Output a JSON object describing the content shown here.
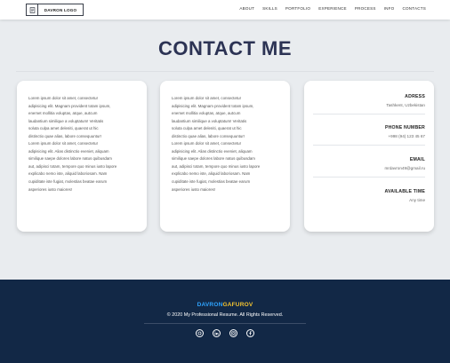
{
  "header": {
    "logo_text": "DAVRON LOGO",
    "nav": [
      "ABOUT",
      "SKILLS",
      "PORTFOLIO",
      "EXPERIENCE",
      "PROCESS",
      "INFO",
      "CONTACTS"
    ]
  },
  "main": {
    "title": "CONTACT ME",
    "card1_lines": [
      "Lorem ipsum dolor sit amet, consectetur",
      "adipisicing elit. Magnam provident totam ipsum,",
      "enemet mollitia voluptas, atque, autcum",
      "laudantium similique a voluptatum! Veritatis",
      "soluta culpa amet deleniti, quaerat ut hic",
      "distinctio quae alias, labore consequuntur!",
      "Lorem ipsum dolor sit amet, consectetur",
      "adipisicing elit. Alias distinctio eveniet, aliquam",
      "similique saepe dolores labore natus quibusdam",
      "aut, adipisci totam, tempore quo minus iusto lapore",
      "explicabo nemo iste, aliquid laboriosam. Nam",
      "cupiditate iste fugiat, molestias beatae earum",
      "asperiores iusto maiores!"
    ],
    "card2_lines": [
      "Lorem ipsum dolor sit amet, consectetur",
      "adipisicing elit. Magnam provident totam ipsum,",
      "enemet mollitia voluptas, atque, autcum",
      "laudantium similique a voluptatum! Veritatis",
      "soluta culpa amet deleniti, quaerat ut hic",
      "distinctio quae alias, labore consequuntur!",
      "Lorem ipsum dolor sit amet, consectetur",
      "adipisicing elit. Alias distinctio eveniet, aliquam",
      "similique saepe dolores labore natus quibusdam",
      "aut, adipisci totam, tempore quo minus iusto lapore",
      "explicabo nemo iste, aliquid laboriosam. Nam",
      "cupiditate iste fugiat, molestias beatae earum",
      "asperiores iusto maiores!"
    ],
    "info": {
      "address_label": "ADRESS",
      "address_value": "Tashkent, Uzbekistan",
      "phone_label": "PHONE NUMBER",
      "phone_value": "+998 (94) 123 45 67",
      "email_label": "EMAIL",
      "email_value": "mrdavron49@gmail.ru",
      "time_label": "AVAILABLE TIME",
      "time_value": "Any time"
    }
  },
  "footer": {
    "brand_part1": "DAVRON",
    "brand_part2": "GAFUROV",
    "copyright": "© 2020 My Professional Resume. All Rights Reserved.",
    "socials": [
      "github-icon",
      "linkedin-icon",
      "instagram-icon",
      "facebook-icon"
    ]
  }
}
